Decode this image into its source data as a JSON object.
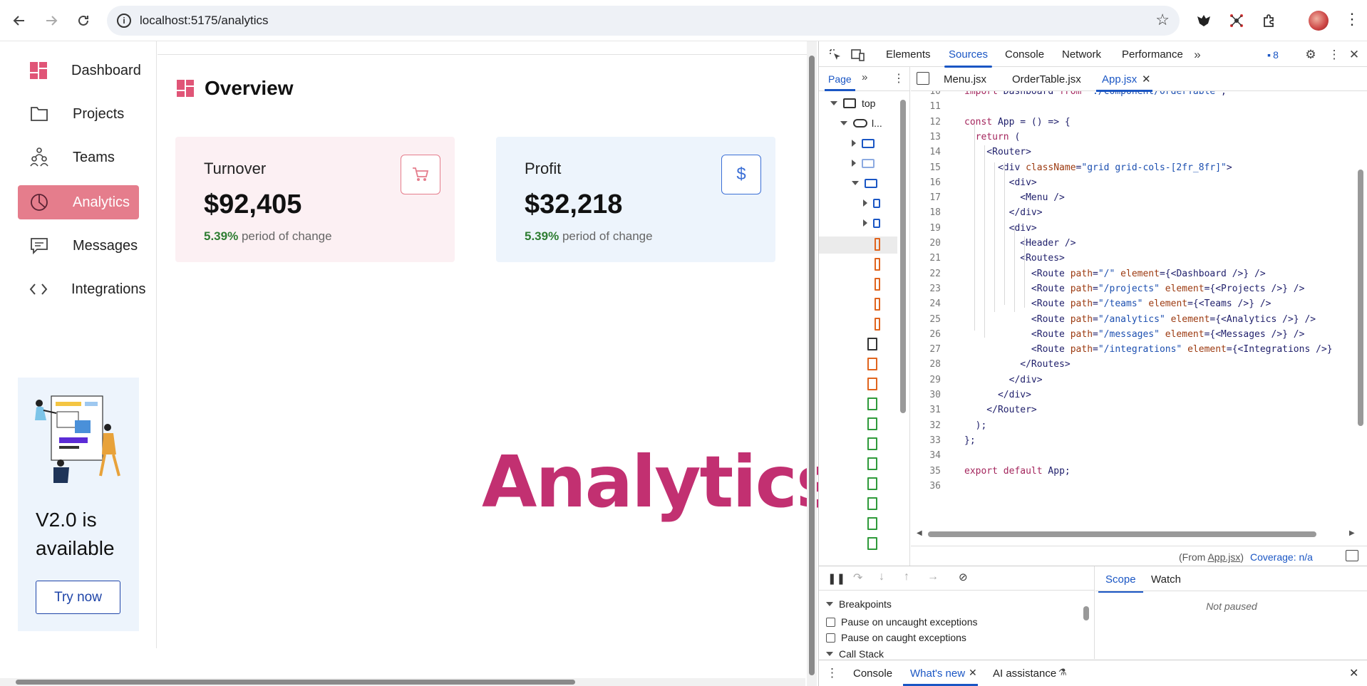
{
  "browser": {
    "url": "localhost:5175/analytics"
  },
  "sidebar": {
    "items": [
      {
        "label": "Dashboard",
        "icon": "dashboard-icon"
      },
      {
        "label": "Projects",
        "icon": "folder-icon"
      },
      {
        "label": "Teams",
        "icon": "teams-icon"
      },
      {
        "label": "Analytics",
        "icon": "pie-chart-icon",
        "active": true
      },
      {
        "label": "Messages",
        "icon": "message-icon"
      },
      {
        "label": "Integrations",
        "icon": "code-icon"
      }
    ],
    "promo": {
      "title": "V2.0 is available",
      "button": "Try now"
    }
  },
  "main": {
    "title": "Overview",
    "cards": [
      {
        "title": "Turnover",
        "value": "$92,405",
        "change": "5.39%",
        "change_text": "period of change",
        "bg": "#fcf0f3",
        "accent": "#e57d8c",
        "icon": "cart-icon"
      },
      {
        "title": "Profit",
        "value": "$32,218",
        "change": "5.39%",
        "change_text": "period of change",
        "bg": "#edf4fc",
        "accent": "#3b6fd6",
        "icon": "dollar-icon"
      }
    ],
    "page_heading": "Analytics"
  },
  "devtools": {
    "tabs": [
      "Elements",
      "Sources",
      "Console",
      "Network",
      "Performance"
    ],
    "active_tab": "Sources",
    "issues_count": "8",
    "nav_tab": "Page",
    "tree_top": "top",
    "tree_host": "l...",
    "editor_tabs": [
      "Menu.jsx",
      "OrderTable.jsx",
      "App.jsx"
    ],
    "active_editor_tab": "App.jsx",
    "code_lines": [
      {
        "n": "10",
        "text": "import Dashboard from \"./component/OrderTable\";"
      },
      {
        "n": "11",
        "text": ""
      },
      {
        "n": "12",
        "text": "const App = () => {"
      },
      {
        "n": "13",
        "text": "  return ("
      },
      {
        "n": "14",
        "text": "    <Router>"
      },
      {
        "n": "15",
        "text": "      <div className=\"grid grid-cols-[2fr_8fr]\">"
      },
      {
        "n": "16",
        "text": "        <div>"
      },
      {
        "n": "17",
        "text": "          <Menu />"
      },
      {
        "n": "18",
        "text": "        </div>"
      },
      {
        "n": "19",
        "text": "        <div>"
      },
      {
        "n": "20",
        "text": "          <Header />"
      },
      {
        "n": "21",
        "text": "          <Routes>"
      },
      {
        "n": "22",
        "text": "            <Route path=\"/\" element={<Dashboard />} />"
      },
      {
        "n": "23",
        "text": "            <Route path=\"/projects\" element={<Projects />} />"
      },
      {
        "n": "24",
        "text": "            <Route path=\"/teams\" element={<Teams />} />"
      },
      {
        "n": "25",
        "text": "            <Route path=\"/analytics\" element={<Analytics />} />"
      },
      {
        "n": "26",
        "text": "            <Route path=\"/messages\" element={<Messages />} />"
      },
      {
        "n": "27",
        "text": "            <Route path=\"/integrations\" element={<Integrations />}"
      },
      {
        "n": "28",
        "text": "          </Routes>"
      },
      {
        "n": "29",
        "text": "        </div>"
      },
      {
        "n": "30",
        "text": "      </div>"
      },
      {
        "n": "31",
        "text": "    </Router>"
      },
      {
        "n": "32",
        "text": "  );"
      },
      {
        "n": "33",
        "text": "};"
      },
      {
        "n": "34",
        "text": ""
      },
      {
        "n": "35",
        "text": "export default App;"
      },
      {
        "n": "36",
        "text": ""
      }
    ],
    "status_from": "(From ",
    "status_file": "App.jsx",
    "status_from_end": ")",
    "coverage": "Coverage: n/a",
    "breakpoints_label": "Breakpoints",
    "pause_uncaught": "Pause on uncaught exceptions",
    "pause_caught": "Pause on caught exceptions",
    "call_stack": "Call Stack",
    "scope_tab": "Scope",
    "watch_tab": "Watch",
    "not_paused": "Not paused",
    "drawer_tabs": [
      "Console",
      "What's new",
      "AI assistance"
    ],
    "active_drawer_tab": "What's new"
  },
  "colors": {
    "accent_pink": "#e57d8c",
    "heading_magenta": "#c23071",
    "positive_green": "#2e7d32",
    "devtools_blue": "#1a56c4"
  }
}
